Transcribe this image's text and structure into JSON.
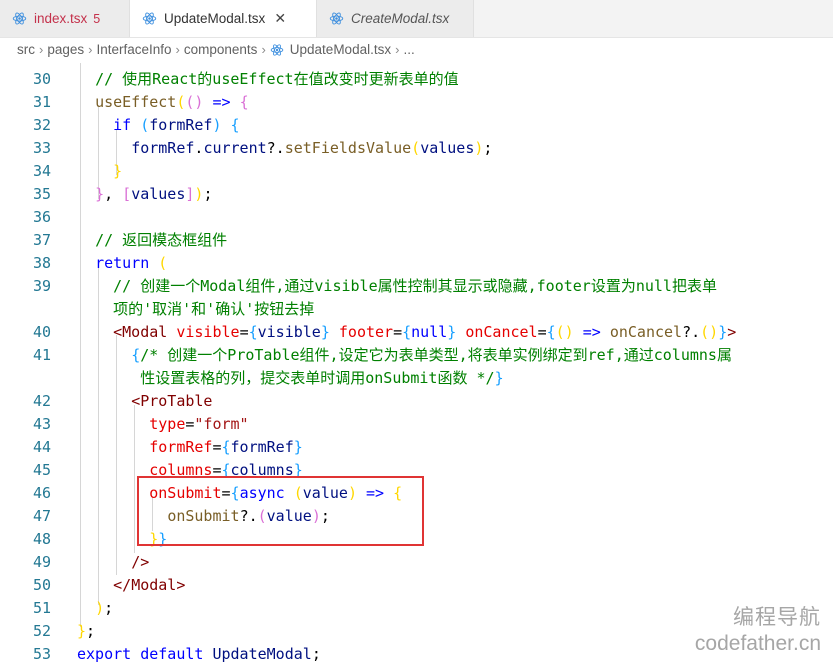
{
  "tabs": [
    {
      "label": "index.tsx",
      "badge": "5",
      "state": "error",
      "active": false
    },
    {
      "label": "UpdateModal.tsx",
      "close": "✕",
      "active": true
    },
    {
      "label": "CreateModal.tsx",
      "preview": true,
      "active": false
    }
  ],
  "breadcrumb": [
    "src",
    "pages",
    "InterfaceInfo",
    "components",
    "UpdateModal.tsx",
    "..."
  ],
  "code": {
    "l30": {
      "num": "30",
      "comment": "// 使用React的useEffect在值改变时更新表单的值"
    },
    "l31": {
      "num": "31",
      "fn": "useEffect",
      "arrow": "=>"
    },
    "l32": {
      "num": "32",
      "kw": "if",
      "cond": "formRef"
    },
    "l33": {
      "num": "33",
      "obj": "formRef",
      "prop": "current",
      "method": "setFieldsValue",
      "arg": "values"
    },
    "l34": {
      "num": "34"
    },
    "l35": {
      "num": "35",
      "dep": "values"
    },
    "l36": {
      "num": "36"
    },
    "l37": {
      "num": "37",
      "comment": "// 返回模态框组件"
    },
    "l38": {
      "num": "38",
      "kw": "return"
    },
    "l39": {
      "num": "39",
      "comment_a": "// 创建一个Modal组件,通过visible属性控制其显示或隐藏,footer设置为null把表单",
      "comment_b": "项的'取消'和'确认'按钮去掉"
    },
    "l40": {
      "num": "40",
      "tag": "Modal",
      "a1": "visible",
      "v1": "visible",
      "a2": "footer",
      "v2": "null",
      "a3": "onCancel",
      "call": "onCancel"
    },
    "l41": {
      "num": "41",
      "comment_a": "/* 创建一个ProTable组件,设定它为表单类型,将表单实例绑定到ref,通过columns属",
      "comment_b": "性设置表格的列，提交表单时调用onSubmit函数 */"
    },
    "l42": {
      "num": "42",
      "tag": "ProTable"
    },
    "l43": {
      "num": "43",
      "attr": "type",
      "str": "\"form\""
    },
    "l44": {
      "num": "44",
      "attr": "formRef",
      "val": "formRef"
    },
    "l45": {
      "num": "45",
      "attr": "columns",
      "val": "columns"
    },
    "l46": {
      "num": "46",
      "attr": "onSubmit",
      "kw": "async",
      "param": "value"
    },
    "l47": {
      "num": "47",
      "call": "onSubmit",
      "arg": "value"
    },
    "l48": {
      "num": "48"
    },
    "l49": {
      "num": "49",
      "close": "/>"
    },
    "l50": {
      "num": "50",
      "tag": "Modal"
    },
    "l51": {
      "num": "51"
    },
    "l52": {
      "num": "52"
    },
    "l53": {
      "num": "53",
      "kw1": "export",
      "kw2": "default",
      "name": "UpdateModal"
    }
  },
  "watermark": {
    "line1": "编程导航",
    "line2": "codefather.cn"
  },
  "colors": {
    "react_icon": "#3a8dde",
    "highlight_box": "#e03434",
    "line_number": "#237893"
  }
}
